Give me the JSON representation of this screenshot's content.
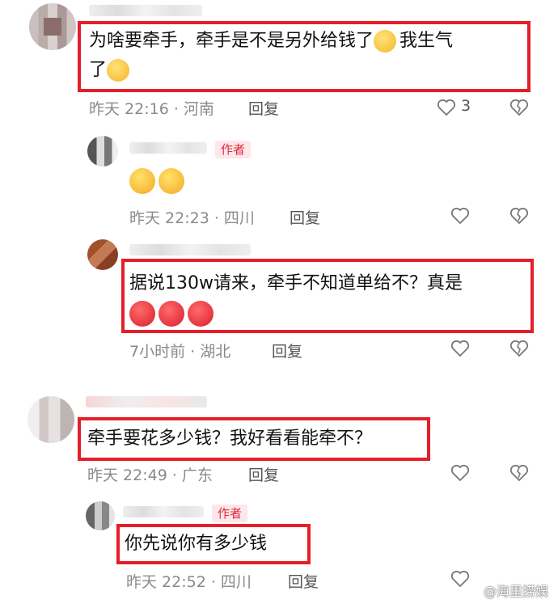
{
  "comments": [
    {
      "text1": "为啥要牵手，牵手是不是另外给钱了",
      "text2": "我生气",
      "text3": "了",
      "time": "昨天 22:16 · 河南",
      "reply": "回复",
      "likes": "3"
    },
    {
      "tag": "作者",
      "time": "昨天 22:23 · 四川",
      "reply": "回复"
    },
    {
      "text1": "据说130w请来，牵手不知道单给不？真是",
      "time": "7小时前 · 湖北",
      "reply": "回复"
    },
    {
      "text1": "牵手要花多少钱？我好看看能牵不？",
      "time": "昨天 22:49 · 广东",
      "reply": "回复"
    },
    {
      "tag": "作者",
      "text1": "你先说你有多少钱",
      "time": "昨天 22:52 · 四川",
      "reply": "回复"
    }
  ],
  "watermark": "@海里捞娱",
  "colors": {
    "highlight_border": "#e31f2a",
    "author_tag": "#e0283d",
    "meta": "#8a8a8a"
  },
  "icons": [
    "heart-icon",
    "broken-heart-icon",
    "shy-emoji",
    "laugh-cry-emoji",
    "angry-emoji"
  ]
}
